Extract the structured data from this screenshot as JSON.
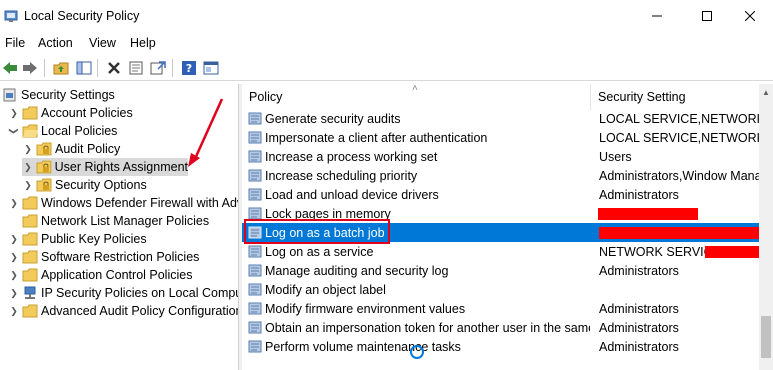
{
  "window": {
    "title": "Local Security Policy",
    "minimize_icon": "minimize-icon",
    "maximize_icon": "maximize-icon",
    "close_icon": "close-icon"
  },
  "menubar": {
    "items": [
      "File",
      "Action",
      "View",
      "Help"
    ]
  },
  "toolbar": {
    "buttons": [
      "back-icon",
      "forward-icon",
      "up-folder-icon",
      "show-hide-tree-icon",
      "delete-icon",
      "properties-icon",
      "export-list-icon",
      "help-icon",
      "console-icon"
    ]
  },
  "tree": {
    "root": "Security Settings",
    "items": [
      {
        "label": "Account Policies"
      },
      {
        "label": "Local Policies"
      },
      {
        "label": "Audit Policy"
      },
      {
        "label": "User Rights Assignment"
      },
      {
        "label": "Security Options"
      },
      {
        "label": "Windows Defender Firewall with Adva"
      },
      {
        "label": "Network List Manager Policies"
      },
      {
        "label": "Public Key Policies"
      },
      {
        "label": "Software Restriction Policies"
      },
      {
        "label": "Application Control Policies"
      },
      {
        "label": "IP Security Policies on Local Compute"
      },
      {
        "label": "Advanced Audit Policy Configuration"
      }
    ]
  },
  "list": {
    "columns": [
      "Policy",
      "Security Setting"
    ],
    "rows": [
      {
        "policy": "Generate security audits",
        "setting": "LOCAL SERVICE,NETWORK SER"
      },
      {
        "policy": "Impersonate a client after authentication",
        "setting": "LOCAL SERVICE,NETWORK SER"
      },
      {
        "policy": "Increase a process working set",
        "setting": "Users"
      },
      {
        "policy": "Increase scheduling priority",
        "setting": "Administrators,Window Manag"
      },
      {
        "policy": "Load and unload device drivers",
        "setting": "Administrators"
      },
      {
        "policy": "Lock pages in memory",
        "setting": ""
      },
      {
        "policy": "Log on as a batch job",
        "setting": ""
      },
      {
        "policy": "Log on as a service",
        "setting": "NETWORK SERVICE,"
      },
      {
        "policy": "Manage auditing and security log",
        "setting": "Administrators"
      },
      {
        "policy": "Modify an object label",
        "setting": ""
      },
      {
        "policy": "Modify firmware environment values",
        "setting": "Administrators"
      },
      {
        "policy": "Obtain an impersonation token for another user in the same...",
        "setting": "Administrators"
      },
      {
        "policy": "Perform volume maintenance tasks",
        "setting": "Administrators"
      }
    ]
  },
  "colors": {
    "selection": "#0078d7",
    "annotation_red": "#e0001b",
    "redaction": "#ff0000"
  }
}
